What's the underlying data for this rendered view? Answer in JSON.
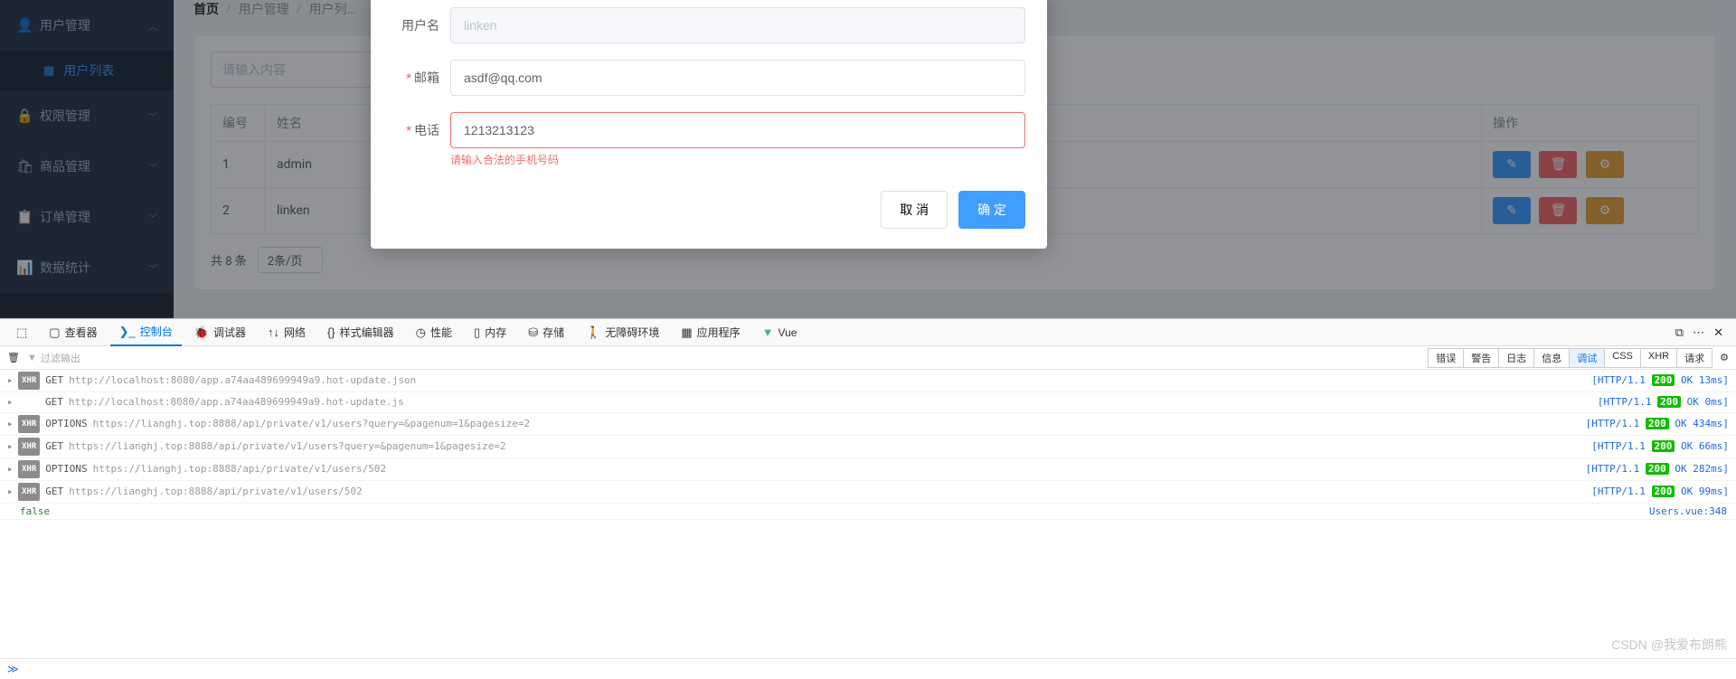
{
  "sidebar": {
    "items": [
      {
        "icon": "👤",
        "label": "用户管理",
        "expanded": true
      },
      {
        "icon": "▦",
        "label": "用户列表",
        "sub": true
      },
      {
        "icon": "🔒",
        "label": "权限管理"
      },
      {
        "icon": "🛍",
        "label": "商品管理"
      },
      {
        "icon": "📋",
        "label": "订单管理"
      },
      {
        "icon": "📊",
        "label": "数据统计"
      }
    ]
  },
  "breadcrumb": [
    "首页",
    "用户管理",
    "用户列…"
  ],
  "card": {
    "search_placeholder": "请输入内容",
    "table": {
      "headers": [
        "编号",
        "姓名",
        "操作"
      ],
      "rows": [
        {
          "id": "1",
          "name": "admin"
        },
        {
          "id": "2",
          "name": "linken"
        }
      ]
    },
    "pagination": {
      "total_label": "共 8 条",
      "page_size": "2条/页"
    }
  },
  "dialog": {
    "username_label": "用户名",
    "username_value": "linken",
    "email_label": "邮箱",
    "email_value": "asdf@qq.com",
    "phone_label": "电话",
    "phone_value": "1213213123",
    "phone_error": "请输入合法的手机号码",
    "cancel": "取 消",
    "confirm": "确 定"
  },
  "devtools": {
    "tabs": [
      "查看器",
      "控制台",
      "调试器",
      "网络",
      "样式编辑器",
      "性能",
      "内存",
      "存储",
      "无障碍环境",
      "应用程序",
      "Vue"
    ],
    "filter_placeholder": "过滤输出",
    "filter_buttons": [
      "错误",
      "警告",
      "日志",
      "信息",
      "调试",
      "CSS",
      "XHR",
      "请求"
    ],
    "active_filter": "调试",
    "logs": [
      {
        "badge": "XHR",
        "method": "GET",
        "url": "http://localhost:8080/app.a74aa489699949a9.hot-update.json",
        "proto": "[HTTP/1.1",
        "code": "200",
        "rest": "OK 13ms]"
      },
      {
        "badge": "",
        "method": "GET",
        "url": "http://localhost:8080/app.a74aa489699949a9.hot-update.js",
        "proto": "[HTTP/1.1",
        "code": "200",
        "rest": "OK 0ms]"
      },
      {
        "badge": "XHR",
        "method": "OPTIONS",
        "url": "https://lianghj.top:8888/api/private/v1/users?query=&pagenum=1&pagesize=2",
        "proto": "[HTTP/1.1",
        "code": "200",
        "rest": "OK 434ms]"
      },
      {
        "badge": "XHR",
        "method": "GET",
        "url": "https://lianghj.top:8888/api/private/v1/users?query=&pagenum=1&pagesize=2",
        "proto": "[HTTP/1.1",
        "code": "200",
        "rest": "OK 66ms]"
      },
      {
        "badge": "XHR",
        "method": "OPTIONS",
        "url": "https://lianghj.top:8888/api/private/v1/users/502",
        "proto": "[HTTP/1.1",
        "code": "200",
        "rest": "OK 282ms]"
      },
      {
        "badge": "XHR",
        "method": "GET",
        "url": "https://lianghj.top:8888/api/private/v1/users/502",
        "proto": "[HTTP/1.1",
        "code": "200",
        "rest": "OK 99ms]"
      }
    ],
    "false_line": "false",
    "source_ref": "Users.vue:348",
    "prompt": "≫"
  },
  "watermark": "CSDN @我爱布朗熊"
}
